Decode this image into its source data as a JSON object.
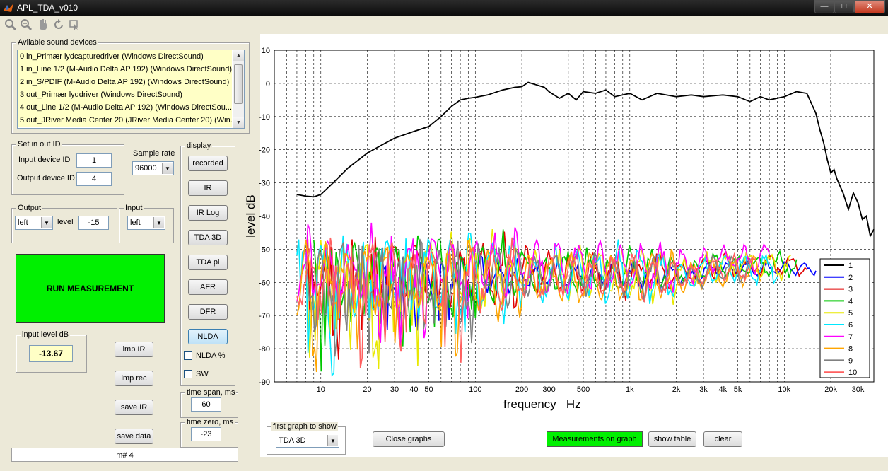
{
  "window": {
    "title": "APL_TDA_v010",
    "min": "—",
    "max": "□",
    "close": "✕"
  },
  "toolbar": {
    "icons": [
      "zoom-in-icon",
      "zoom-out-icon",
      "pan-hand-icon",
      "rotate-icon",
      "data-cursor-icon"
    ]
  },
  "devices": {
    "title": "Avilable sound devices",
    "items": [
      "0 in_Primær lydcapturedriver (Windows DirectSound)",
      "1 in_Line 1/2 (M-Audio Delta AP 192) (Windows DirectSound)",
      "2 in_S/PDIF (M-Audio Delta AP 192) (Windows DirectSound)",
      "3 out_Primær lyddriver (Windows DirectSound)",
      "4 out_Line 1/2 (M-Audio Delta AP 192) (Windows DirectSou...",
      "5 out_JRiver Media Center 20 (JRiver Media Center 20) (Win..."
    ]
  },
  "setio": {
    "title": "Set in out ID",
    "input_label": "Input device ID",
    "input_value": "1",
    "output_label": "Output device ID",
    "output_value": "4"
  },
  "samplerate": {
    "label": "Sample rate",
    "value": "96000"
  },
  "output": {
    "title": "Output",
    "channel": "left",
    "level_label": "level",
    "level_value": "-15"
  },
  "input": {
    "title": "Input",
    "channel": "left"
  },
  "run_label": "RUN MEASUREMENT",
  "inputlevel": {
    "title": "input level dB",
    "value": "-13.67"
  },
  "buttons": {
    "imp_ir": "imp IR",
    "imp_rec": "imp rec",
    "save_ir": "save IR",
    "save_data": "save data"
  },
  "display": {
    "title": "display",
    "buttons": [
      "recorded",
      "IR",
      "IR Log",
      "TDA 3D",
      "TDA pl",
      "AFR",
      "DFR",
      "NLDA"
    ],
    "nlda_pct": "NLDA %",
    "sw": "SW"
  },
  "timespan": {
    "title": "time span, ms",
    "value": "60"
  },
  "timezero": {
    "title": "time zero, ms",
    "value": "-23"
  },
  "status": "m# 4",
  "firstgraph": {
    "title": "first graph to show",
    "value": "TDA 3D"
  },
  "bottom_buttons": {
    "close_graphs": "Close graphs",
    "measurements": "Measurements on graph",
    "show_table": "show table",
    "clear": "clear"
  },
  "colors": {
    "run": "#00f000",
    "field_yellow": "#ffffc6"
  },
  "chart_data": {
    "type": "line",
    "xlabel": "frequency   Hz",
    "ylabel": "level dB",
    "xscale": "log",
    "xlim": [
      5,
      38000
    ],
    "ylim": [
      -90,
      10
    ],
    "grid": true,
    "legend_position": "right",
    "xticks": [
      10,
      20,
      30,
      40,
      50,
      100,
      200,
      300,
      500,
      1000,
      2000,
      3000,
      4000,
      5000,
      10000,
      20000,
      30000
    ],
    "xtick_labels": [
      "10",
      "20",
      "30",
      "40",
      "50",
      "100",
      "200",
      "300",
      "500",
      "1k",
      "2k",
      "3k",
      "4k",
      "5k",
      "10k",
      "20k",
      "30k"
    ],
    "yticks": [
      10,
      0,
      -10,
      -20,
      -30,
      -40,
      -50,
      -60,
      -70,
      -80,
      -90
    ],
    "main_series": {
      "name": "1",
      "color": "#000000",
      "points": [
        [
          7,
          -33.5
        ],
        [
          8,
          -34
        ],
        [
          9,
          -34.2
        ],
        [
          10,
          -33.5
        ],
        [
          12,
          -30
        ],
        [
          15,
          -25.5
        ],
        [
          20,
          -21
        ],
        [
          25,
          -18.5
        ],
        [
          30,
          -16.5
        ],
        [
          40,
          -14.5
        ],
        [
          50,
          -13
        ],
        [
          60,
          -10
        ],
        [
          70,
          -7
        ],
        [
          80,
          -5
        ],
        [
          90,
          -4.5
        ],
        [
          100,
          -4.2
        ],
        [
          120,
          -3.5
        ],
        [
          150,
          -2
        ],
        [
          180,
          -1.2
        ],
        [
          200,
          -1
        ],
        [
          220,
          0.3
        ],
        [
          250,
          -0.5
        ],
        [
          280,
          -1.2
        ],
        [
          300,
          -2.5
        ],
        [
          350,
          -4.5
        ],
        [
          400,
          -3
        ],
        [
          450,
          -5
        ],
        [
          500,
          -2.5
        ],
        [
          600,
          -3
        ],
        [
          700,
          -2
        ],
        [
          800,
          -4
        ],
        [
          1000,
          -3
        ],
        [
          1200,
          -5
        ],
        [
          1500,
          -3
        ],
        [
          2000,
          -4
        ],
        [
          2500,
          -3.5
        ],
        [
          3000,
          -4
        ],
        [
          4000,
          -3.5
        ],
        [
          5000,
          -4
        ],
        [
          6000,
          -5.5
        ],
        [
          7000,
          -4
        ],
        [
          8000,
          -5
        ],
        [
          10000,
          -4
        ],
        [
          12000,
          -2.5
        ],
        [
          14000,
          -3
        ],
        [
          16000,
          -9
        ],
        [
          17000,
          -14
        ],
        [
          18000,
          -18
        ],
        [
          19000,
          -23
        ],
        [
          20000,
          -27
        ],
        [
          21000,
          -26
        ],
        [
          22000,
          -29
        ],
        [
          24000,
          -33
        ],
        [
          26000,
          -38
        ],
        [
          28000,
          -33
        ],
        [
          30000,
          -36
        ],
        [
          32000,
          -41
        ],
        [
          34000,
          -40
        ],
        [
          36000,
          -46
        ],
        [
          38000,
          -44
        ]
      ]
    },
    "series": [
      {
        "name": "1",
        "color": "#000000"
      },
      {
        "name": "2",
        "color": "#0000ff",
        "start": 25,
        "end": 16000,
        "base": -58,
        "amp": 4,
        "phase": 0.7
      },
      {
        "name": "3",
        "color": "#e00000",
        "start": 8,
        "end": 14000,
        "base": -57,
        "amp": 7,
        "phase": 1.3
      },
      {
        "name": "4",
        "color": "#00c800",
        "start": 9,
        "end": 12000,
        "base": -57,
        "amp": 7,
        "phase": 2.1
      },
      {
        "name": "5",
        "color": "#e8e800",
        "start": 8,
        "end": 11000,
        "base": -57,
        "amp": 8,
        "phase": 3.0
      },
      {
        "name": "6",
        "color": "#00e8ff",
        "start": 7,
        "end": 9000,
        "base": -58,
        "amp": 9,
        "phase": 0.2
      },
      {
        "name": "7",
        "color": "#ff00ff",
        "start": 7,
        "end": 8000,
        "base": -55,
        "amp": 8,
        "phase": 4.4
      },
      {
        "name": "8",
        "color": "#ffa500",
        "start": 7,
        "end": 7000,
        "base": -59,
        "amp": 8,
        "phase": 5.2
      },
      {
        "name": "9",
        "color": "#808080",
        "start": 8,
        "end": 6000,
        "base": -58,
        "amp": 7,
        "phase": 2.7
      },
      {
        "name": "10",
        "color": "#ff6060",
        "start": 7,
        "end": 6500,
        "base": -58,
        "amp": 7,
        "phase": 3.6
      }
    ]
  }
}
